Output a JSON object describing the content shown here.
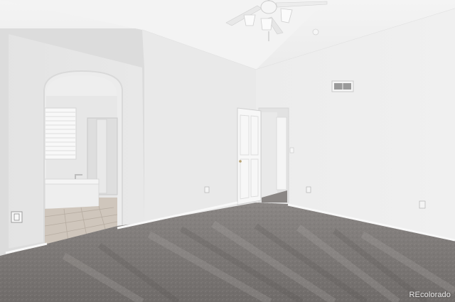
{
  "photo": {
    "subject": "empty-bedroom-with-ensuite-bath",
    "watermark": "REcolorado"
  },
  "colors": {
    "wall_left": "#e6e6e6",
    "wall_right": "#ededed",
    "ceiling": "#f1f1f1",
    "carpet": "#7e7a78",
    "tile": "#cfc6bc",
    "trim": "#f6f6f6"
  },
  "icons": [
    "ceiling-fan-icon",
    "air-vent-icon",
    "power-outlet-icon",
    "door-handle-icon"
  ]
}
